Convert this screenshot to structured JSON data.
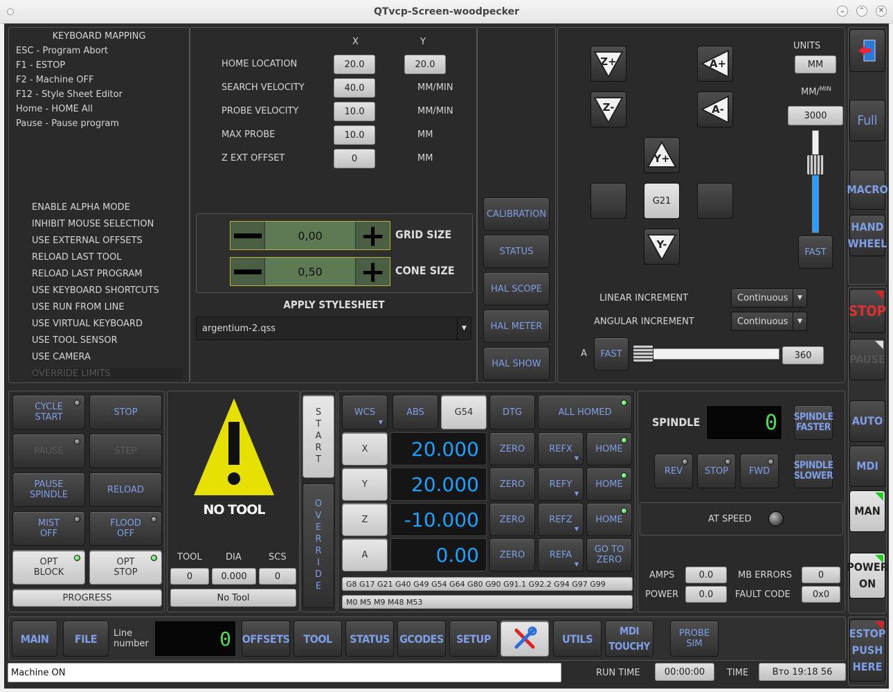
{
  "window": {
    "title": "QTvcp-Screen-woodpecker"
  },
  "keyboard": {
    "header": "KEYBOARD MAPPING",
    "items": [
      "ESC - Program Abort",
      "F1 - ESTOP",
      "F2 - Machine OFF",
      "F12 - Style Sheet Editor",
      "Home - HOME All",
      "Pause - Pause program"
    ]
  },
  "options": {
    "items": [
      "ENABLE ALPHA MODE",
      "INHIBIT MOUSE SELECTION",
      "USE EXTERNAL OFFSETS",
      "RELOAD LAST TOOL",
      "RELOAD LAST PROGRAM",
      "USE KEYBOARD SHORTCUTS",
      "USE RUN FROM LINE",
      "USE VIRTUAL KEYBOARD",
      "USE TOOL SENSOR",
      "USE CAMERA",
      "OVERRIDE LIMITS"
    ]
  },
  "probe": {
    "col_x": "X",
    "col_y": "Y",
    "rows": [
      {
        "label": "HOME LOCATION",
        "x": "20.0",
        "y": "20.0",
        "unit": ""
      },
      {
        "label": "SEARCH VELOCITY",
        "x": "40.0",
        "unit": "MM/MIN"
      },
      {
        "label": "PROBE VELOCITY",
        "x": "10.0",
        "unit": "MM/MIN"
      },
      {
        "label": "MAX PROBE",
        "x": "10.0",
        "unit": "MM"
      },
      {
        "label": "Z EXT OFFSET",
        "x": "0",
        "unit": "MM"
      }
    ]
  },
  "grid": {
    "grid_value": "0,00",
    "grid_label": "GRID SIZE",
    "cone_value": "0,50",
    "cone_label": "CONE SIZE"
  },
  "stylesheet": {
    "label": "APPLY STYLESHEET",
    "value": "argentium-2.qss"
  },
  "tools_col": {
    "buttons": [
      "CALIBRATION",
      "STATUS",
      "HAL SCOPE",
      "HAL METER",
      "HAL SHOW"
    ]
  },
  "jogpanel": {
    "units_label": "UNITS",
    "units_value": "MM",
    "rate_label": "MM/",
    "rate_sup": "MIN",
    "rate_value": "3000",
    "fast": "FAST",
    "center": "G21",
    "linear_label": "LINEAR INCREMENT",
    "linear_value": "Continuous",
    "angular_label": "ANGULAR INCREMENT",
    "angular_value": "Continuous",
    "a_label": "A",
    "a_fast": "FAST",
    "a_value": "360",
    "jog_slider_level": 0.7,
    "a_slider_level": 0.0
  },
  "control": {
    "cycle_start": "CYCLE\nSTART",
    "stop": "STOP",
    "pause": "PAUSE",
    "step": "STEP",
    "pause_spindle": "PAUSE\nSPINDLE",
    "reload": "RELOAD",
    "mist": "MIST\nOFF",
    "flood": "FLOOD\nOFF",
    "opt_block": "OPT\nBLOCK",
    "opt_stop": "OPT\nSTOP",
    "progress": "PROGRESS"
  },
  "tool": {
    "no_tool": "NO TOOL",
    "h_tool": "TOOL",
    "h_dia": "DIA",
    "h_scs": "SCS",
    "v_tool": "0",
    "v_dia": "0.000",
    "v_scs": "0",
    "name": "No Tool"
  },
  "startbar": {
    "start": "START",
    "override": "OVERRIDE"
  },
  "dro": {
    "wcs": "WCS",
    "abs": "ABS",
    "g54": "G54",
    "dtg": "DTG",
    "all_homed": "ALL HOMED",
    "axes": [
      {
        "name": "X",
        "value": "20.000",
        "ref": "REFX",
        "home": "HOME"
      },
      {
        "name": "Y",
        "value": "20.000",
        "ref": "REFY",
        "home": "HOME"
      },
      {
        "name": "Z",
        "value": "-10.000",
        "ref": "REFZ",
        "home": "HOME"
      },
      {
        "name": "A",
        "value": "0.00",
        "ref": "REFA",
        "home": "GO TO\nZERO"
      }
    ],
    "zero": "ZERO",
    "gcodes": "G8 G17 G21 G40 G49 G54 G64 G80 G90 G91.1 G92.2 G94 G97 G99",
    "mcodes": "M0 M5 M9 M48 M53"
  },
  "spindle": {
    "label": "SPINDLE",
    "speed": "0",
    "faster": "SPINDLE\nFASTER",
    "slower": "SPINDLE\nSLOWER",
    "rev": "REV",
    "stop": "STOP",
    "fwd": "FWD",
    "at_speed": "AT SPEED",
    "amps_label": "AMPS",
    "amps": "0.0",
    "power_label": "POWER",
    "power": "0.0",
    "mb_label": "MB ERRORS",
    "mb": "0",
    "fault_label": "FAULT CODE",
    "fault": "0x0"
  },
  "sidebar": {
    "full": "Full",
    "macro": "MACRO",
    "hand": "HAND\nWHEEL",
    "stop": "STOP",
    "pause": "PAUSE",
    "auto": "AUTO",
    "mdi": "MDI",
    "man": "MAN",
    "power": "POWER\nON",
    "estop": "ESTOP\nPUSH\nHERE"
  },
  "bottom": {
    "main": "MAIN",
    "file": "FILE",
    "line_label": "Line\nnumber",
    "line_value": "0",
    "offsets": "OFFSETS",
    "tool": "TOOL",
    "status": "STATUS",
    "gcodes": "GCODES",
    "setup": "SETUP",
    "utils": "UTILS",
    "mdi_touchy": "MDI\nTOUCHY",
    "probe_sim": "PROBE\nSIM"
  },
  "statusbar": {
    "message": "Machine ON",
    "run_label": "RUN TIME",
    "run_value": "00:00:00",
    "time_label": "TIME",
    "time_value": "Вто 19:18 56"
  },
  "colors": {
    "accent": "#7f9ee6",
    "dro": "#1aa2ff",
    "led_green": "#1fbf2f",
    "stop_red": "#e03030"
  }
}
